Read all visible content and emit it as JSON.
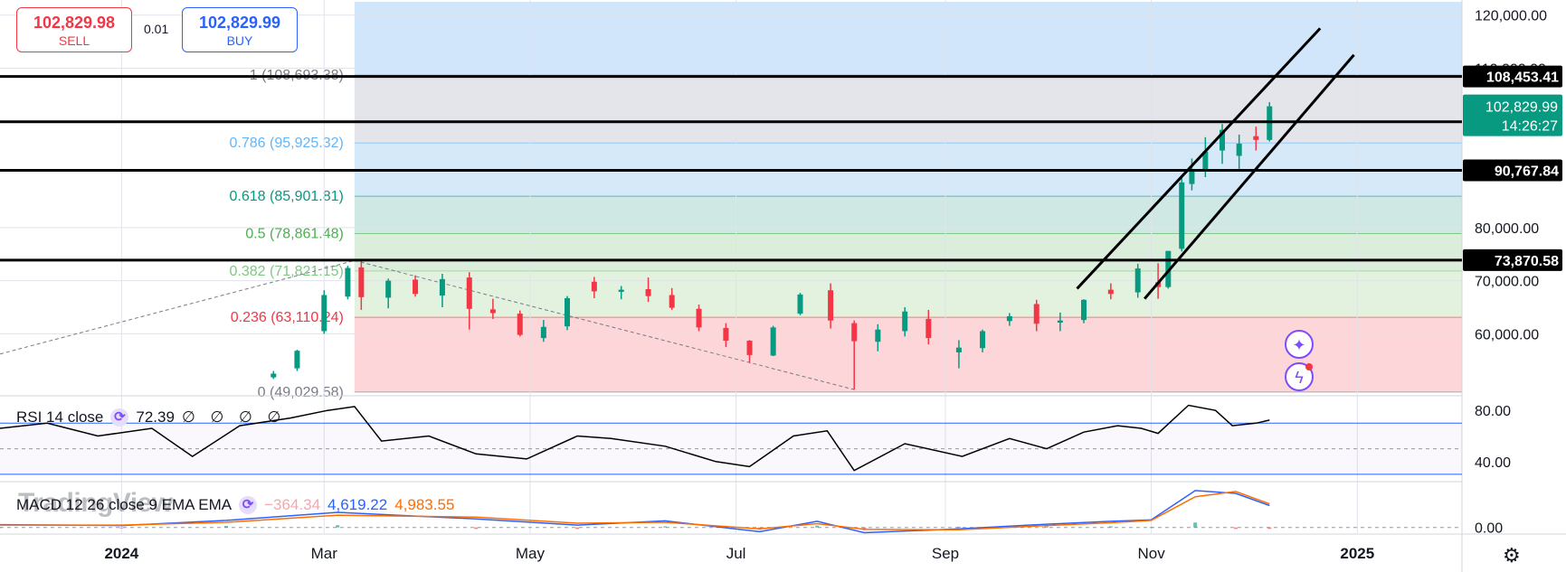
{
  "trade": {
    "sell": {
      "price": "102,829.98",
      "label": "SELL"
    },
    "spread": "0.01",
    "buy": {
      "price": "102,829.99",
      "label": "BUY"
    }
  },
  "colors": {
    "up": "#089981",
    "down": "#f23645",
    "rsi": "#000000",
    "macd": "#2962ff",
    "signal": "#ff6d00",
    "zone_top": "#d1e5fb",
    "zone_grey": "#e0e3eb"
  },
  "watermark": "TradingView",
  "icons": [
    "sparkle-icon",
    "lightning-icon",
    "gear-icon"
  ],
  "chart_data": [
    {
      "type": "candlestick",
      "y_axis_ticks": [
        "120,000.00",
        "110,000.00",
        "80,000.00",
        "70,000.00",
        "60,000.00"
      ],
      "y_axis_values": [
        120000,
        110000,
        80000,
        70000,
        60000
      ],
      "ylim": [
        48500,
        122500
      ],
      "x_tick_labels": [
        "2024",
        "Mar",
        "May",
        "Jul",
        "Sep",
        "Nov",
        "2025"
      ],
      "x_tick_dates": [
        "2024-01-01",
        "2024-03-01",
        "2024-05-01",
        "2024-07-01",
        "2024-09-01",
        "2024-11-01",
        "2025-01-01"
      ],
      "xlim": [
        "2023-11-26",
        "2025-02-01"
      ],
      "grid": true,
      "fibonacci": {
        "start_date": "2024-03-10",
        "levels": [
          {
            "label": "1 (108,693.38)",
            "ratio": 1,
            "value": 108693.38,
            "color": "#787b86"
          },
          {
            "label": "0.786 (95,925.32)",
            "ratio": 0.786,
            "value": 95925.32,
            "color": "#64b5f6"
          },
          {
            "label": "0.618 (85,901.81)",
            "ratio": 0.618,
            "value": 85901.81,
            "color": "#089981"
          },
          {
            "label": "0.5 (78,861.48)",
            "ratio": 0.5,
            "value": 78861.48,
            "color": "#4caf50"
          },
          {
            "label": "0.382 (71,821.15)",
            "ratio": 0.382,
            "value": 71821.15,
            "color": "#81c784"
          },
          {
            "label": "0.236 (63,110.24)",
            "ratio": 0.236,
            "value": 63110.24,
            "color": "#f23645"
          },
          {
            "label": "0 (49,029.58)",
            "ratio": 0,
            "value": 49029.58,
            "color": "#787b86"
          }
        ]
      },
      "horizontal_lines": [
        {
          "value": 108453.41,
          "label": "108,453.41"
        },
        {
          "value": 99912.24,
          "label": "99,912.24"
        },
        {
          "value": 90767.84,
          "label": "90,767.84"
        },
        {
          "value": 73870.58,
          "label": "73,870.58"
        }
      ],
      "last_price": {
        "value": 102829.99,
        "label": "102,829.99",
        "countdown": "14:26:27"
      },
      "channel": [
        {
          "from": [
            "2024-10-10",
            68500
          ],
          "to": [
            "2024-12-21",
            117500
          ]
        },
        {
          "from": [
            "2024-10-30",
            66600
          ],
          "to": [
            "2024-12-31",
            112500
          ]
        }
      ],
      "trend_lines": [
        {
          "from": [
            "2023-11-26",
            56200
          ],
          "to": [
            "2024-03-10",
            73800
          ]
        },
        {
          "from": [
            "2024-03-10",
            73800
          ],
          "to": [
            "2024-08-05",
            49500
          ]
        }
      ],
      "series": [
        {
          "dates": [
            "2024-02-15",
            "2024-02-22",
            "2024-03-01",
            "2024-03-08",
            "2024-03-12",
            "2024-03-20",
            "2024-03-28",
            "2024-04-05",
            "2024-04-13",
            "2024-04-20",
            "2024-04-28",
            "2024-05-05",
            "2024-05-12",
            "2024-05-20",
            "2024-05-28",
            "2024-06-05",
            "2024-06-12",
            "2024-06-20",
            "2024-06-28",
            "2024-07-05",
            "2024-07-12",
            "2024-07-20",
            "2024-07-29",
            "2024-08-05",
            "2024-08-12",
            "2024-08-20",
            "2024-08-27",
            "2024-09-05",
            "2024-09-12",
            "2024-09-20",
            "2024-09-28",
            "2024-10-05",
            "2024-10-12",
            "2024-10-20",
            "2024-10-28",
            "2024-11-03",
            "2024-11-06",
            "2024-11-10",
            "2024-11-13",
            "2024-11-17",
            "2024-11-22",
            "2024-11-27",
            "2024-12-02",
            "2024-12-06"
          ],
          "open": [
            51800,
            53500,
            60500,
            67000,
            72500,
            66800,
            70200,
            67200,
            70600,
            64600,
            63800,
            59200,
            61400,
            69800,
            67900,
            68400,
            67300,
            64700,
            61100,
            58700,
            55900,
            63800,
            68200,
            62000,
            58500,
            60500,
            62800,
            56500,
            57300,
            62400,
            65600,
            62100,
            62600,
            68300,
            67800,
            69700,
            68800,
            76000,
            88200,
            91000,
            94500,
            93500,
            97200,
            96500
          ],
          "high": [
            53000,
            57000,
            68200,
            72800,
            73800,
            70400,
            71000,
            71300,
            71600,
            66600,
            64400,
            62600,
            67100,
            70700,
            69000,
            70600,
            68600,
            65500,
            62000,
            58800,
            61500,
            67700,
            69500,
            62500,
            61800,
            65000,
            64500,
            58800,
            60800,
            63900,
            66400,
            64000,
            66500,
            69500,
            73200,
            73300,
            75600,
            89400,
            93000,
            97000,
            99500,
            97500,
            99000,
            103600
          ],
          "low": [
            51500,
            53000,
            60000,
            66500,
            64500,
            64800,
            67000,
            65000,
            60800,
            62800,
            59500,
            58500,
            60700,
            66700,
            66500,
            66000,
            64500,
            60500,
            57500,
            54500,
            55800,
            63500,
            61000,
            49500,
            56700,
            59500,
            58000,
            53500,
            56500,
            61500,
            60500,
            60500,
            62000,
            66500,
            66800,
            66600,
            68500,
            75500,
            87000,
            89500,
            92000,
            90800,
            94500,
            96200
          ],
          "close": [
            52500,
            56800,
            67300,
            72400,
            66900,
            70000,
            67500,
            70300,
            64700,
            63900,
            59800,
            61300,
            66700,
            68000,
            68300,
            67100,
            64900,
            61200,
            58700,
            56000,
            61200,
            67400,
            62500,
            58600,
            60800,
            64200,
            59200,
            57400,
            60500,
            63300,
            61900,
            62500,
            66400,
            67500,
            72300,
            68800,
            75600,
            88500,
            90900,
            94300,
            98400,
            95800,
            96500,
            102830
          ]
        }
      ]
    },
    {
      "type": "line",
      "legend": "RSI 14 close",
      "value_label": "72.39",
      "null_values": "∅ ∅ ∅ ∅",
      "y_axis_ticks": [
        "80.00",
        "40.00"
      ],
      "y_axis_values": [
        80,
        40
      ],
      "ylim": [
        25,
        90
      ],
      "bands": [
        70,
        50,
        30
      ],
      "series": [
        {
          "dates": [
            "2023-11-26",
            "2023-12-10",
            "2023-12-25",
            "2024-01-10",
            "2024-01-22",
            "2024-02-05",
            "2024-02-20",
            "2024-03-02",
            "2024-03-10",
            "2024-03-18",
            "2024-04-01",
            "2024-04-15",
            "2024-04-30",
            "2024-05-15",
            "2024-05-25",
            "2024-06-10",
            "2024-06-25",
            "2024-07-05",
            "2024-07-18",
            "2024-07-28",
            "2024-08-05",
            "2024-08-20",
            "2024-09-06",
            "2024-09-20",
            "2024-10-01",
            "2024-10-12",
            "2024-10-22",
            "2024-10-29",
            "2024-11-03",
            "2024-11-12",
            "2024-11-20",
            "2024-11-25",
            "2024-12-02",
            "2024-12-06"
          ],
          "values": [
            66,
            70,
            60,
            66,
            44,
            68,
            74,
            80,
            83,
            56,
            60,
            46,
            42,
            60,
            58,
            52,
            40,
            36,
            60,
            64,
            33,
            54,
            44,
            58,
            50,
            63,
            68,
            66,
            62,
            84,
            80,
            68,
            70,
            72.39
          ]
        }
      ]
    },
    {
      "type": "line",
      "legend": "MACD 12 26 close 9 EMA EMA",
      "values_label": [
        "−364.34",
        "4,619.22",
        "4,983.55"
      ],
      "y_axis_ticks": [
        "0.00"
      ],
      "y_axis_values": [
        0
      ],
      "ylim": [
        -1200,
        9500
      ],
      "series": [
        {
          "name": "MACD",
          "dates": [
            "2023-11-26",
            "2024-01-01",
            "2024-02-01",
            "2024-03-05",
            "2024-04-15",
            "2024-05-15",
            "2024-06-10",
            "2024-07-08",
            "2024-07-25",
            "2024-08-08",
            "2024-09-05",
            "2024-10-01",
            "2024-10-20",
            "2024-11-01",
            "2024-11-14",
            "2024-11-26",
            "2024-12-06"
          ],
          "values": [
            600,
            400,
            1500,
            3200,
            1800,
            500,
            1400,
            -900,
            1300,
            -1100,
            -300,
            700,
            1300,
            1600,
            7800,
            7200,
            4619.22
          ]
        },
        {
          "name": "Signal",
          "dates": [
            "2023-11-26",
            "2024-01-01",
            "2024-02-01",
            "2024-03-05",
            "2024-04-15",
            "2024-05-15",
            "2024-06-10",
            "2024-07-08",
            "2024-07-25",
            "2024-08-08",
            "2024-09-05",
            "2024-10-01",
            "2024-10-20",
            "2024-11-01",
            "2024-11-14",
            "2024-11-26",
            "2024-12-06"
          ],
          "values": [
            500,
            500,
            1100,
            2600,
            2200,
            900,
            1100,
            -300,
            800,
            -400,
            -500,
            400,
            1000,
            1500,
            6500,
            7600,
            4983.55
          ]
        }
      ]
    }
  ]
}
